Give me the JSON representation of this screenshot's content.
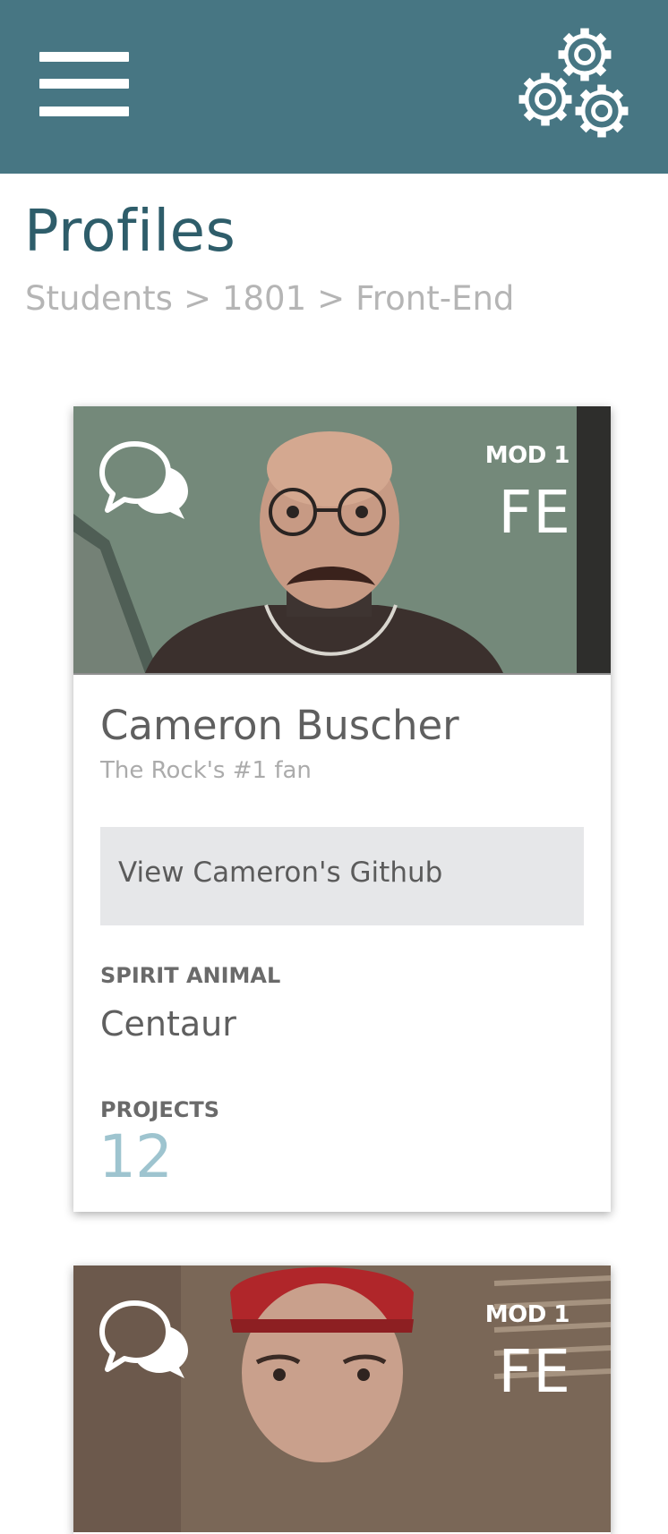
{
  "colors": {
    "header_bar": "#477683",
    "title": "#2e5d6a",
    "breadcrumb": "#b5b5b5",
    "projects_accent": "#9ec4cf",
    "button_bg": "#e6e7e9"
  },
  "header": {
    "menu_icon": "hamburger-icon",
    "settings_icon": "gears-icon"
  },
  "page": {
    "title": "Profiles",
    "breadcrumb": [
      "Students",
      "1801",
      "Front-End"
    ],
    "breadcrumb_separator": ">"
  },
  "profiles": [
    {
      "photo": "student-photo",
      "chat_icon": "chat-bubbles-icon",
      "mod": "MOD 1",
      "track": "FE",
      "name": "Cameron Buscher",
      "tagline": "The Rock's #1 fan",
      "github_button": "View Cameron's Github",
      "spirit_animal_label": "SPIRIT ANIMAL",
      "spirit_animal": "Centaur",
      "projects_label": "PROJECTS",
      "projects": "12"
    },
    {
      "photo": "student-photo",
      "chat_icon": "chat-bubbles-icon",
      "mod": "MOD 1",
      "track": "FE"
    }
  ]
}
